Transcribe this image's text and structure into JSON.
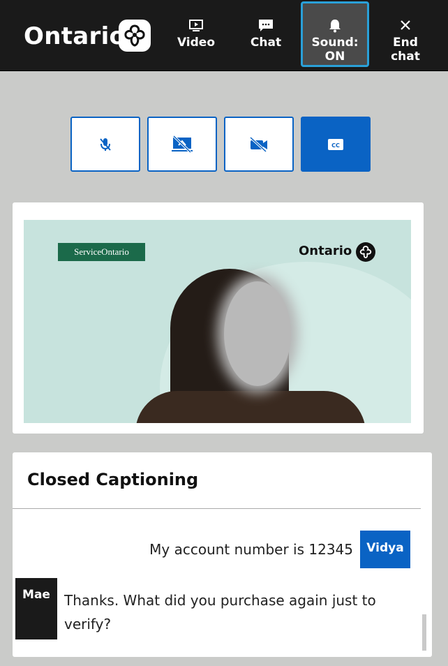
{
  "brand": {
    "name": "Ontario"
  },
  "nav": {
    "video_label": "Video",
    "chat_label": "Chat",
    "sound_label_line1": "Sound:",
    "sound_label_line2": "ON",
    "end_label_line1": "End",
    "end_label_line2": "chat"
  },
  "controls": [
    {
      "icon": "microphone-muted-icon",
      "state": "off"
    },
    {
      "icon": "screen-share-off-icon",
      "state": "off"
    },
    {
      "icon": "camera-off-icon",
      "state": "off"
    },
    {
      "icon": "closed-caption-icon",
      "state": "on"
    }
  ],
  "video": {
    "badge_text": "ServiceOntario",
    "watermark_text": "Ontario"
  },
  "captions": {
    "title": "Closed Captioning",
    "messages": [
      {
        "speaker": "Vidya",
        "text": "My account number is 12345",
        "align": "right"
      },
      {
        "speaker": "Mae",
        "text": "Thanks. What did you purchase again just to verify?",
        "align": "left"
      }
    ]
  },
  "colors": {
    "accent_blue": "#0a63c4",
    "active_outline": "#2aa0d8",
    "header_bg": "#1a1a1a",
    "page_bg": "#cacbc9"
  }
}
